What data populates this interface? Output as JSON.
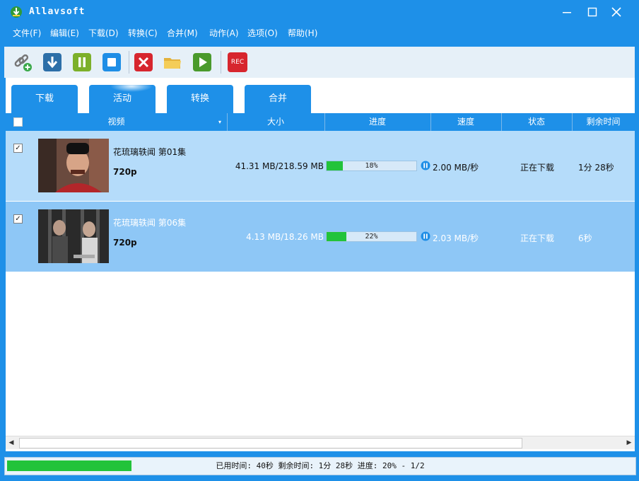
{
  "window": {
    "title": "Allavsoft"
  },
  "menu": [
    "文件(F)",
    "编辑(E)",
    "下载(D)",
    "转换(C)",
    "合并(M)",
    "动作(A)",
    "选项(O)",
    "帮助(H)"
  ],
  "toolbar": {
    "rec_label": "REC"
  },
  "tabs": [
    "下载",
    "活动",
    "转换",
    "合并"
  ],
  "active_tab": "活动",
  "columns": [
    "视频",
    "大小",
    "进度",
    "速度",
    "状态",
    "剩余时间"
  ],
  "rows": [
    {
      "checked": "✓",
      "title": "花琉璃轶闻 第01集",
      "resolution": "720p",
      "size": "41.31 MB/218.59 MB",
      "progress": 18,
      "progress_label": "18%",
      "speed": "2.00 MB/秒",
      "status": "正在下载",
      "remaining": "1分 28秒"
    },
    {
      "checked": "✓",
      "title": "花琉璃轶闻 第06集",
      "resolution": "720p",
      "size": "4.13 MB/18.26 MB",
      "progress": 22,
      "progress_label": "22%",
      "speed": "2.03 MB/秒",
      "status": "正在下载",
      "remaining": "6秒"
    }
  ],
  "statusbar": {
    "text": "已用时间: 40秒 剩余时间: 1分 28秒 进度: 20% - 1/2",
    "progress": 20
  },
  "colors": {
    "accent": "#1e90e8",
    "progress_green": "#22c33a",
    "row_selected": "#b5dcfa",
    "row_alt": "#8ec7f6"
  }
}
